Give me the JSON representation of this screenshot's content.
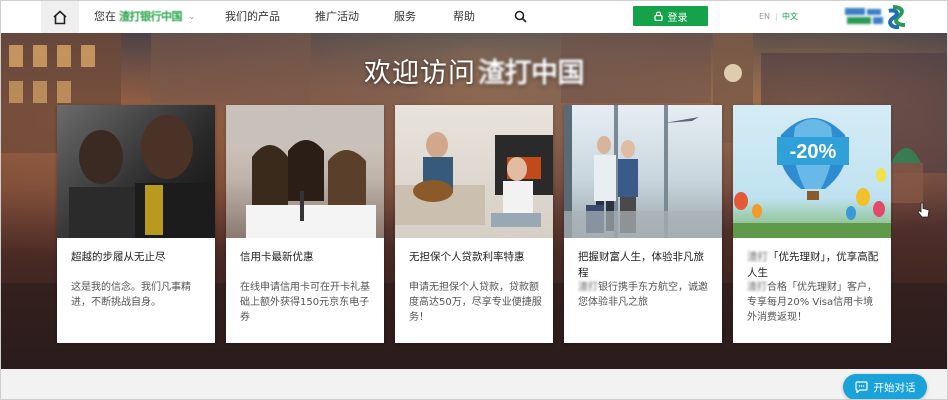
{
  "header": {
    "location_label": "您在",
    "location_brand": "渣打银行中国",
    "nav": [
      "我们的产品",
      "推广活动",
      "服务",
      "帮助"
    ],
    "login_label": "登录",
    "lang_en": "EN",
    "lang_sep": "|",
    "lang_zh": "中文"
  },
  "hero": {
    "title": "欢迎访问",
    "title_brand": "渣打中国"
  },
  "cards": [
    {
      "title": "超越的步履从无止尽",
      "desc": "这是我的信念。我们凡事精进，不断挑战自身。"
    },
    {
      "title": "信用卡最新优惠",
      "desc": "在线申请信用卡可在开卡礼基础上额外获得150元京东电子券"
    },
    {
      "title": "无担保个人贷款利率特惠",
      "desc": "申请无担保个人贷款，贷款额度高达50万，尽享专业便捷服务！"
    },
    {
      "title": "把握财富人生，体验非凡旅程",
      "desc_blur": "渣打",
      "desc": "银行携手东方航空，诚邀您体验非凡之旅"
    },
    {
      "title_blur": "渣打",
      "title": "「优先理财」，优享高配人生",
      "desc_blur": "渣打",
      "desc": "合格「优先理财」客户，专享每月20% Visa信用卡境外消费返现！",
      "balloon_text": "-20%"
    }
  ],
  "chat": {
    "label": "开始对话"
  },
  "colors": {
    "accent_green": "#16a24a",
    "chat_blue": "#1aa3d9"
  }
}
